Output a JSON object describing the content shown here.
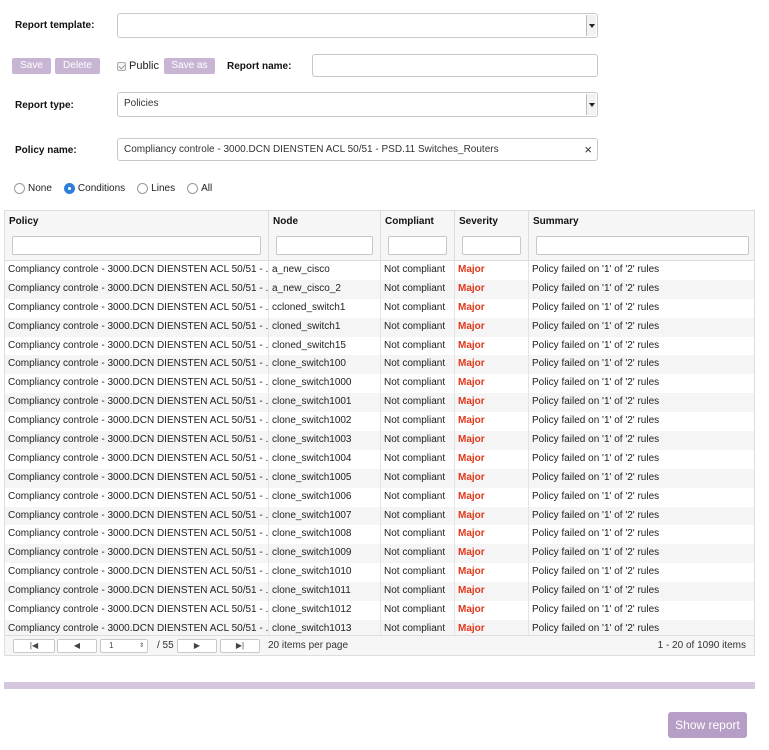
{
  "form": {
    "report_template_label": "Report template:",
    "report_template_value": "",
    "save_label": "Save",
    "delete_label": "Delete",
    "public_label": "Public",
    "save_as_label": "Save as",
    "report_name_label": "Report name:",
    "report_name_value": "",
    "report_type_label": "Report type:",
    "report_type_value": "Policies",
    "policy_name_label": "Policy name:",
    "policy_name_value": "Compliancy controle - 3000.DCN DIENSTEN ACL 50/51 - PSD.11 Switches_Routers",
    "clear_icon": "×"
  },
  "detail_options": [
    {
      "label": "None",
      "selected": false
    },
    {
      "label": "Conditions",
      "selected": true
    },
    {
      "label": "Lines",
      "selected": false
    },
    {
      "label": "All",
      "selected": false
    }
  ],
  "table": {
    "columns": [
      "Policy",
      "Node",
      "Compliant",
      "Severity",
      "Summary"
    ],
    "rows": [
      [
        "Compliancy controle - 3000.DCN DIENSTEN ACL 50/51 - ...",
        "a_new_cisco",
        "Not compliant",
        "Major",
        "Policy failed on '1' of '2' rules"
      ],
      [
        "Compliancy controle - 3000.DCN DIENSTEN ACL 50/51 - ...",
        "a_new_cisco_2",
        "Not compliant",
        "Major",
        "Policy failed on '1' of '2' rules"
      ],
      [
        "Compliancy controle - 3000.DCN DIENSTEN ACL 50/51 - ...",
        "ccloned_switch1",
        "Not compliant",
        "Major",
        "Policy failed on '1' of '2' rules"
      ],
      [
        "Compliancy controle - 3000.DCN DIENSTEN ACL 50/51 - ...",
        "cloned_switch1",
        "Not compliant",
        "Major",
        "Policy failed on '1' of '2' rules"
      ],
      [
        "Compliancy controle - 3000.DCN DIENSTEN ACL 50/51 - ...",
        "cloned_switch15",
        "Not compliant",
        "Major",
        "Policy failed on '1' of '2' rules"
      ],
      [
        "Compliancy controle - 3000.DCN DIENSTEN ACL 50/51 - ...",
        "clone_switch100",
        "Not compliant",
        "Major",
        "Policy failed on '1' of '2' rules"
      ],
      [
        "Compliancy controle - 3000.DCN DIENSTEN ACL 50/51 - ...",
        "clone_switch1000",
        "Not compliant",
        "Major",
        "Policy failed on '1' of '2' rules"
      ],
      [
        "Compliancy controle - 3000.DCN DIENSTEN ACL 50/51 - ...",
        "clone_switch1001",
        "Not compliant",
        "Major",
        "Policy failed on '1' of '2' rules"
      ],
      [
        "Compliancy controle - 3000.DCN DIENSTEN ACL 50/51 - ...",
        "clone_switch1002",
        "Not compliant",
        "Major",
        "Policy failed on '1' of '2' rules"
      ],
      [
        "Compliancy controle - 3000.DCN DIENSTEN ACL 50/51 - ...",
        "clone_switch1003",
        "Not compliant",
        "Major",
        "Policy failed on '1' of '2' rules"
      ],
      [
        "Compliancy controle - 3000.DCN DIENSTEN ACL 50/51 - ...",
        "clone_switch1004",
        "Not compliant",
        "Major",
        "Policy failed on '1' of '2' rules"
      ],
      [
        "Compliancy controle - 3000.DCN DIENSTEN ACL 50/51 - ...",
        "clone_switch1005",
        "Not compliant",
        "Major",
        "Policy failed on '1' of '2' rules"
      ],
      [
        "Compliancy controle - 3000.DCN DIENSTEN ACL 50/51 - ...",
        "clone_switch1006",
        "Not compliant",
        "Major",
        "Policy failed on '1' of '2' rules"
      ],
      [
        "Compliancy controle - 3000.DCN DIENSTEN ACL 50/51 - ...",
        "clone_switch1007",
        "Not compliant",
        "Major",
        "Policy failed on '1' of '2' rules"
      ],
      [
        "Compliancy controle - 3000.DCN DIENSTEN ACL 50/51 - ...",
        "clone_switch1008",
        "Not compliant",
        "Major",
        "Policy failed on '1' of '2' rules"
      ],
      [
        "Compliancy controle - 3000.DCN DIENSTEN ACL 50/51 - ...",
        "clone_switch1009",
        "Not compliant",
        "Major",
        "Policy failed on '1' of '2' rules"
      ],
      [
        "Compliancy controle - 3000.DCN DIENSTEN ACL 50/51 - ...",
        "clone_switch1010",
        "Not compliant",
        "Major",
        "Policy failed on '1' of '2' rules"
      ],
      [
        "Compliancy controle - 3000.DCN DIENSTEN ACL 50/51 - ...",
        "clone_switch1011",
        "Not compliant",
        "Major",
        "Policy failed on '1' of '2' rules"
      ],
      [
        "Compliancy controle - 3000.DCN DIENSTEN ACL 50/51 - ...",
        "clone_switch1012",
        "Not compliant",
        "Major",
        "Policy failed on '1' of '2' rules"
      ],
      [
        "Compliancy controle - 3000.DCN DIENSTEN ACL 50/51 - ...",
        "clone_switch1013",
        "Not compliant",
        "Major",
        "Policy failed on '1' of '2' rules"
      ]
    ]
  },
  "pager": {
    "page": "1",
    "total_pages": "/ 55",
    "per_page": "20 items per page",
    "range": "1 - 20 of 1090 items"
  },
  "actions": {
    "show_report_label": "Show report"
  },
  "colors": {
    "accent": "#c8b5d3",
    "severity_major": "#e0381a",
    "radio_selected": "#2f7fd8"
  }
}
